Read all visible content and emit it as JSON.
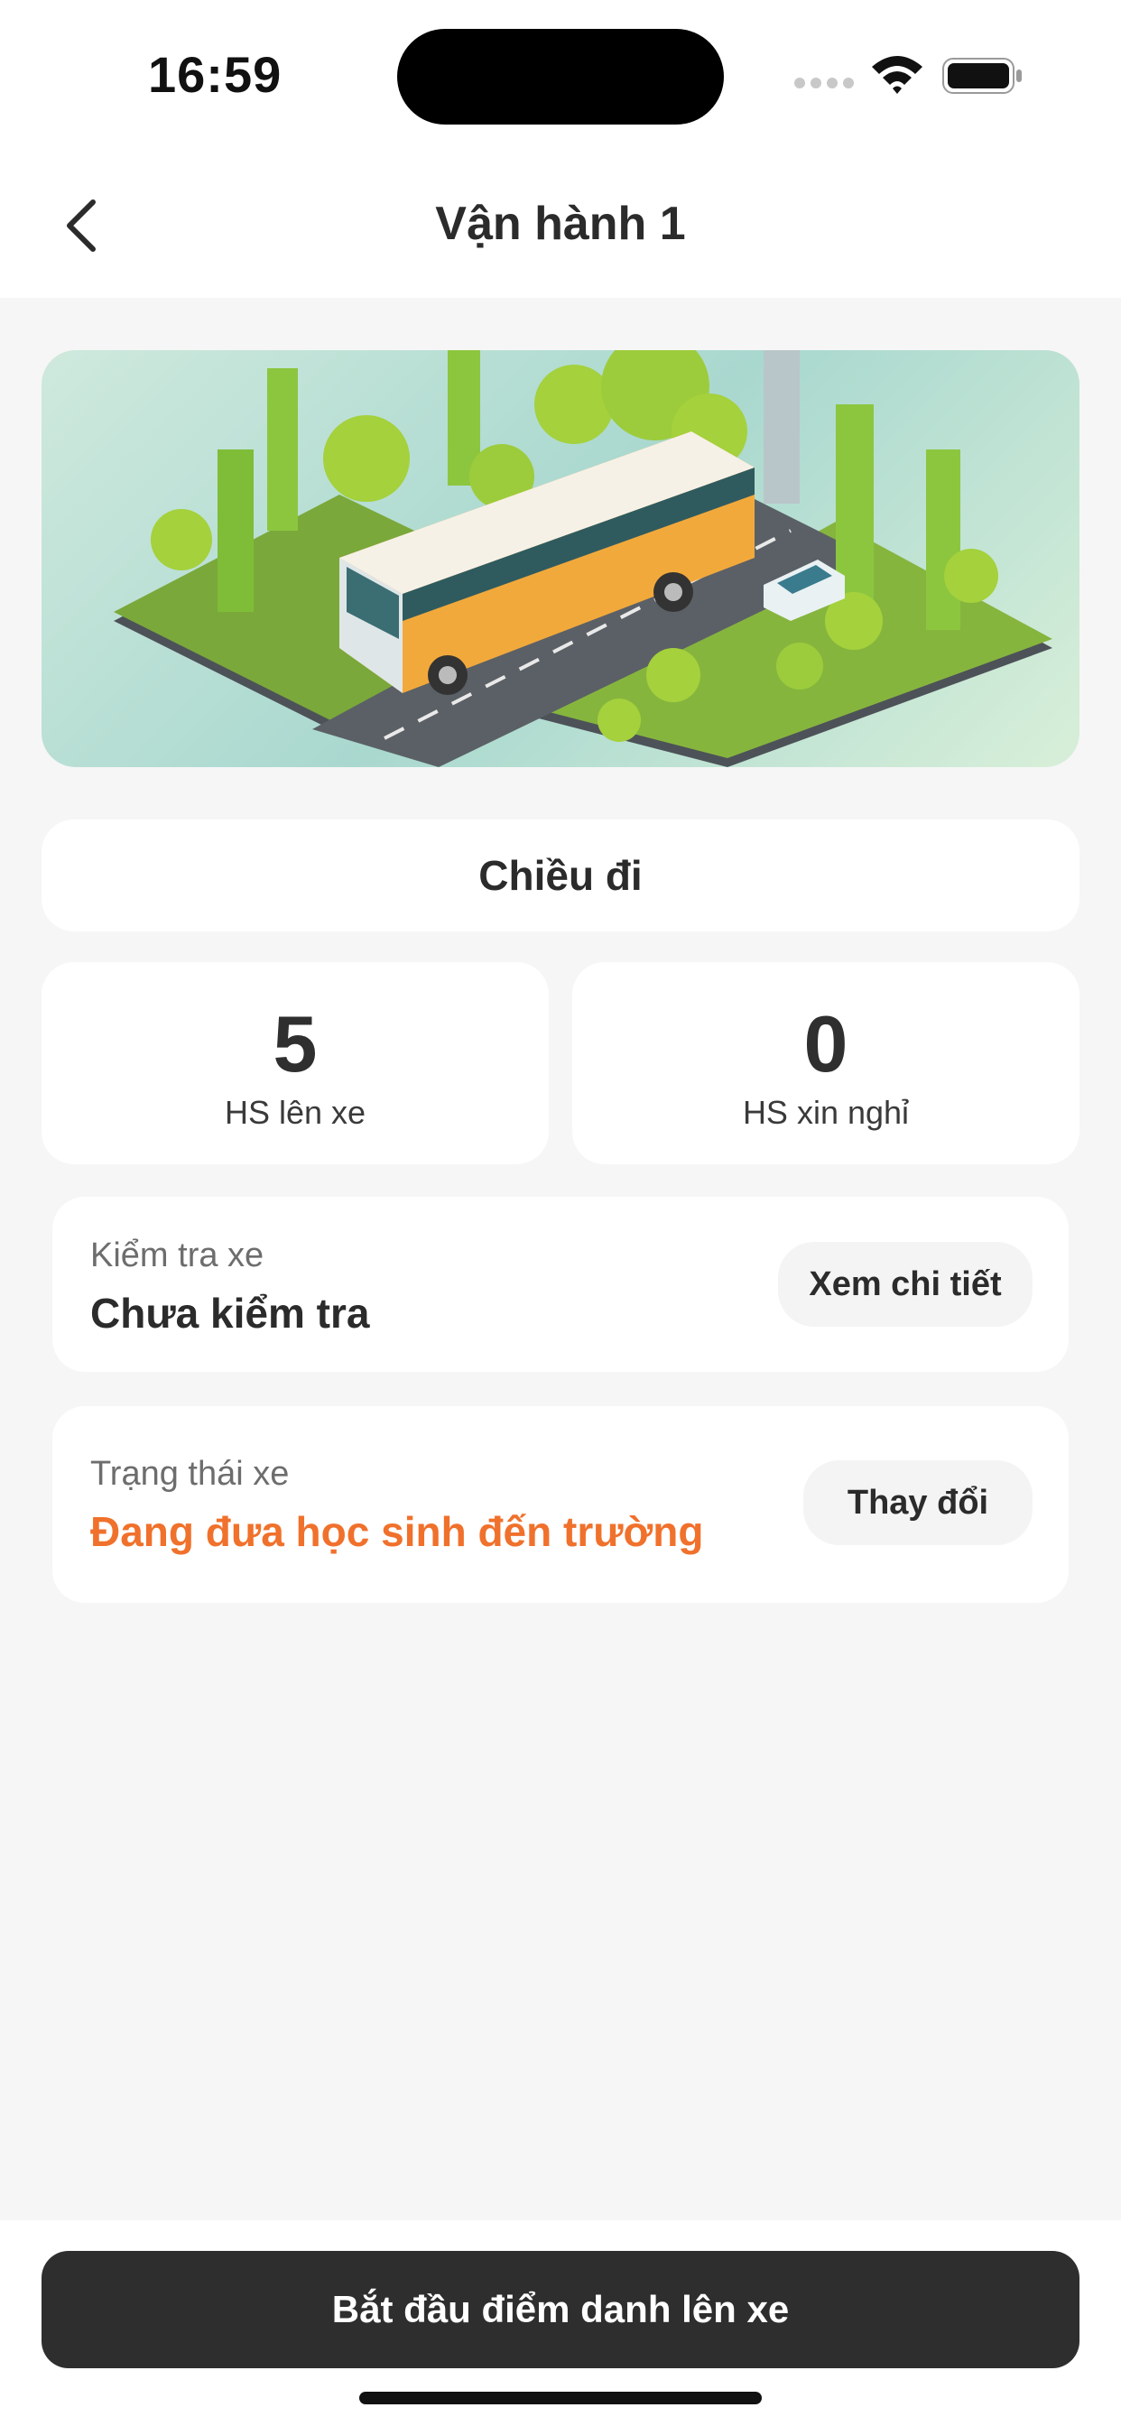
{
  "status_bar": {
    "time": "16:59"
  },
  "header": {
    "title": "Vận hành 1",
    "back_icon": "chevron-left-icon"
  },
  "banner": {
    "image": "isometric-bus-illustration",
    "colors": {
      "bus_body": "#f2a93b",
      "bus_roof": "#f6f1e6",
      "trees": "#9ccc3c",
      "road": "#5b6066"
    }
  },
  "direction": {
    "label": "Chiều đi"
  },
  "stats": [
    {
      "value": "5",
      "label": "HS lên xe"
    },
    {
      "value": "0",
      "label": "HS xin nghỉ"
    }
  ],
  "vehicle_check": {
    "label": "Kiểm tra xe",
    "value": "Chưa kiểm tra",
    "button": "Xem chi tiết"
  },
  "vehicle_status": {
    "label": "Trạng thái xe",
    "value": "Đang đưa học sinh đến trường",
    "button": "Thay đổi",
    "value_color": "#f0712c"
  },
  "primary_action": {
    "label": "Bắt đầu điểm danh lên xe"
  }
}
